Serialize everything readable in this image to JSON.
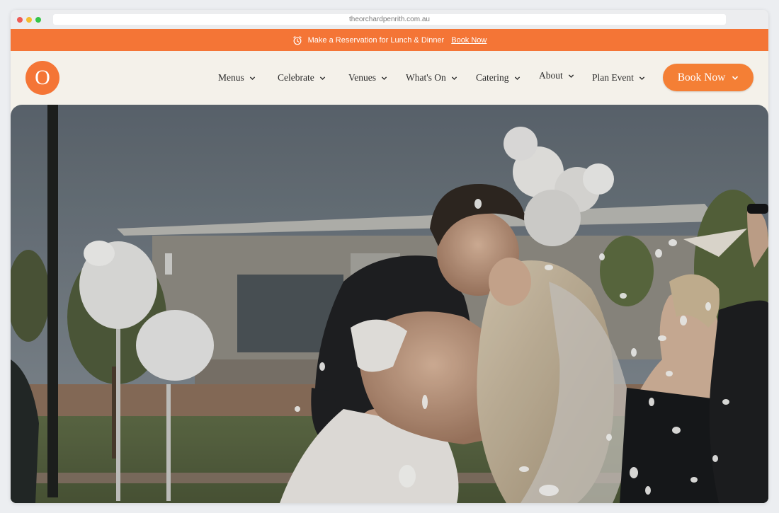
{
  "browser": {
    "url": "theorchardpenrith.com.au"
  },
  "promo": {
    "text": "Make a Reservation for Lunch & Dinner",
    "link": "Book Now",
    "clock_icon": "alarm-clock-icon"
  },
  "logo": {
    "letter": "O"
  },
  "nav": {
    "items": [
      {
        "label": "Menus"
      },
      {
        "label": "Celebrate"
      },
      {
        "label": "Venues"
      },
      {
        "label": "What's On"
      },
      {
        "label": "Catering"
      },
      {
        "label": "About"
      },
      {
        "label": "Plan Event"
      }
    ],
    "book_label": "Book Now"
  },
  "colors": {
    "brand": "#f47536",
    "cream": "#f4f1ea"
  }
}
